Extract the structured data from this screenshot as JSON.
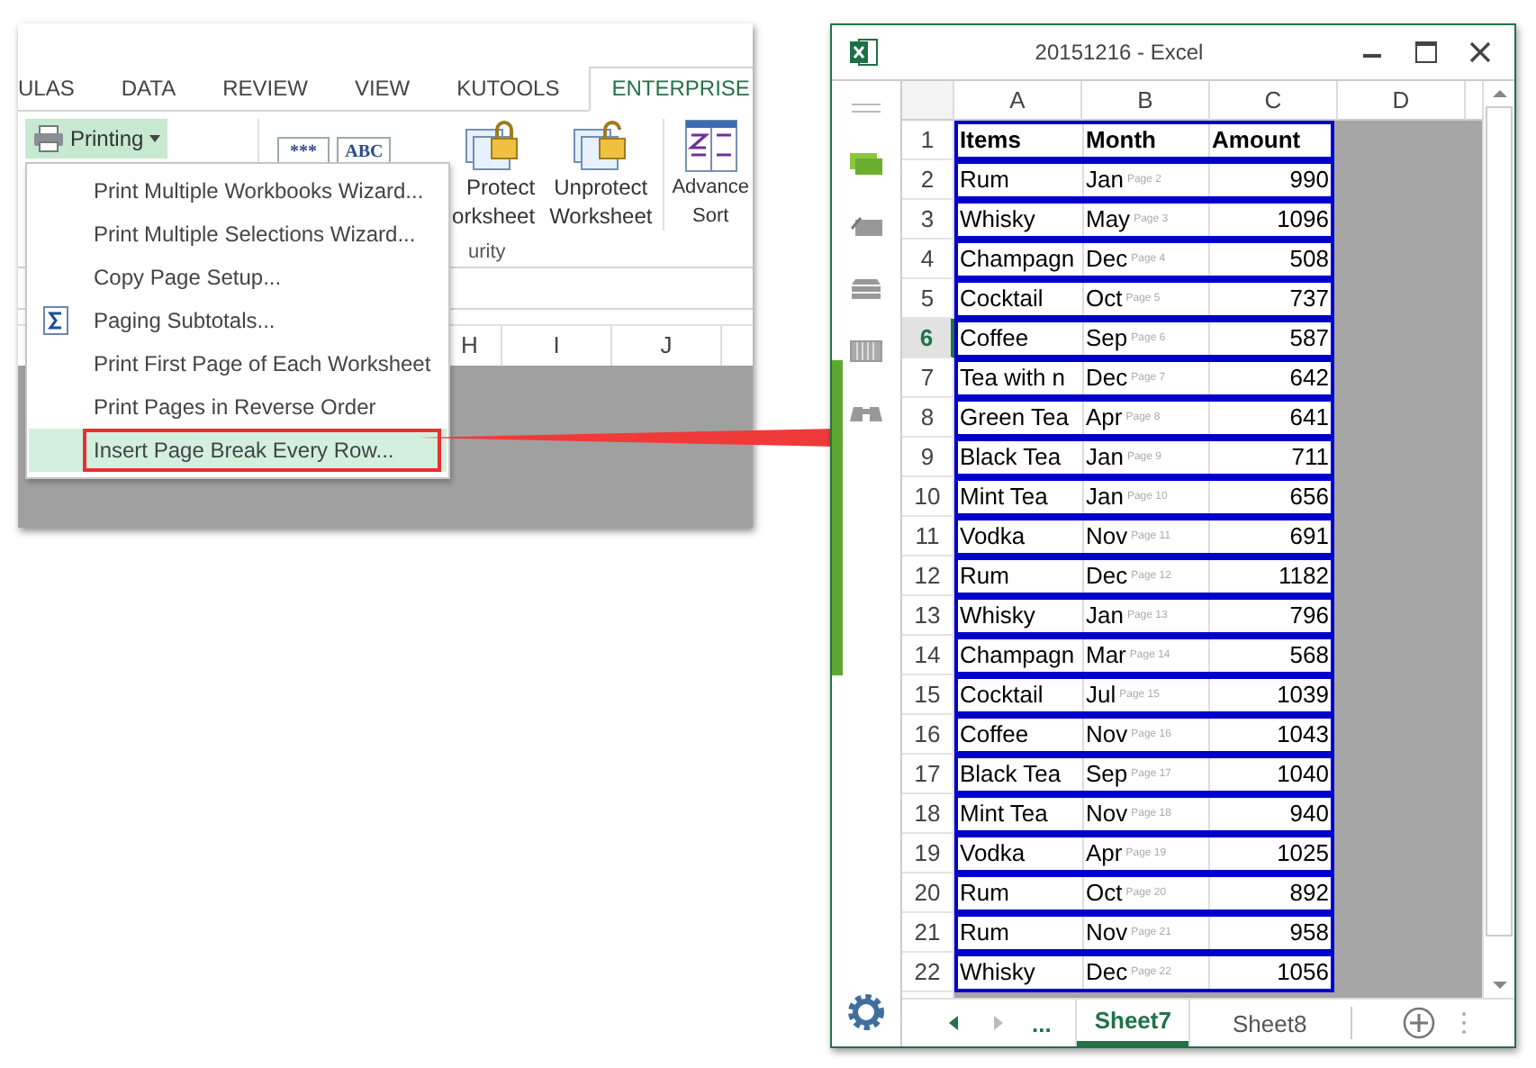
{
  "left_window": {
    "ribbon_tabs": [
      {
        "label": "ULAS",
        "selected": false
      },
      {
        "label": "DATA",
        "selected": false
      },
      {
        "label": "REVIEW",
        "selected": false
      },
      {
        "label": "VIEW",
        "selected": false
      },
      {
        "label": "KUTOOLS",
        "selected": false
      },
      {
        "label": "ENTERPRISE",
        "selected": true
      }
    ],
    "printing_button": {
      "label": "Printing",
      "expanded": true
    },
    "ribbon_icons": [
      "***",
      "ABC"
    ],
    "ribbon_buttons": [
      {
        "kind": "lock",
        "lines": [
          "Protect",
          "orksheet"
        ]
      },
      {
        "kind": "unlock",
        "lines": [
          "Unprotect",
          "Worksheet"
        ]
      },
      {
        "kind": "sort",
        "lines": [
          "Advance",
          "Sort"
        ]
      }
    ],
    "group_label": "urity",
    "column_headers": [
      "H",
      "I",
      "J"
    ],
    "menu": [
      {
        "label": "Print Multiple Workbooks Wizard...",
        "kind": "plain",
        "selected": false,
        "annotated": false
      },
      {
        "label": "Print Multiple Selections Wizard...",
        "kind": "plain",
        "selected": false,
        "annotated": false
      },
      {
        "label": "Copy Page Setup...",
        "kind": "plain",
        "selected": false,
        "annotated": false
      },
      {
        "label": "Paging Subtotals...",
        "kind": "subtotal",
        "selected": false,
        "annotated": false
      },
      {
        "label": "Print First Page of Each Worksheet",
        "kind": "plain",
        "selected": false,
        "annotated": false
      },
      {
        "label": "Print Pages in Reverse Order",
        "kind": "plain",
        "selected": false,
        "annotated": false
      },
      {
        "label": "Insert Page Break Every Row...",
        "kind": "plain",
        "selected": true,
        "annotated": true
      }
    ]
  },
  "excel_window": {
    "title": "20151216 - Excel",
    "columns": [
      "A",
      "B",
      "C",
      "D"
    ],
    "rows": [
      {
        "num": "1",
        "items": "Items",
        "month": "Month",
        "amount": "Amount",
        "kind": "header",
        "selected": false
      },
      {
        "num": "2",
        "items": "Rum",
        "month": "Jan",
        "page": "Page 2",
        "amount": "990",
        "kind": "data",
        "selected": false
      },
      {
        "num": "3",
        "items": "Whisky",
        "month": "May",
        "page": "Page 3",
        "amount": "1096",
        "kind": "data",
        "selected": false
      },
      {
        "num": "4",
        "items": "Champagn",
        "month": "Dec",
        "page": "Page 4",
        "amount": "508",
        "kind": "data",
        "selected": false
      },
      {
        "num": "5",
        "items": "Cocktail",
        "month": "Oct",
        "page": "Page 5",
        "amount": "737",
        "kind": "data",
        "selected": false
      },
      {
        "num": "6",
        "items": "Coffee",
        "month": "Sep",
        "page": "Page 6",
        "amount": "587",
        "kind": "data",
        "selected": true
      },
      {
        "num": "7",
        "items": "Tea with n",
        "month": "Dec",
        "page": "Page 7",
        "amount": "642",
        "kind": "data",
        "selected": false
      },
      {
        "num": "8",
        "items": "Green Tea",
        "month": "Apr",
        "page": "Page 8",
        "amount": "641",
        "kind": "data",
        "selected": false
      },
      {
        "num": "9",
        "items": "Black Tea",
        "month": "Jan",
        "page": "Page 9",
        "amount": "711",
        "kind": "data",
        "selected": false
      },
      {
        "num": "10",
        "items": "Mint Tea",
        "month": "Jan",
        "page": "Page 10",
        "amount": "656",
        "kind": "data",
        "selected": false
      },
      {
        "num": "11",
        "items": "Vodka",
        "month": "Nov",
        "page": "Page 11",
        "amount": "691",
        "kind": "data",
        "selected": false
      },
      {
        "num": "12",
        "items": "Rum",
        "month": "Dec",
        "page": "Page 12",
        "amount": "1182",
        "kind": "data",
        "selected": false
      },
      {
        "num": "13",
        "items": "Whisky",
        "month": "Jan",
        "page": "Page 13",
        "amount": "796",
        "kind": "data",
        "selected": false
      },
      {
        "num": "14",
        "items": "Champagn",
        "month": "Mar",
        "page": "Page 14",
        "amount": "568",
        "kind": "data",
        "selected": false
      },
      {
        "num": "15",
        "items": "Cocktail",
        "month": "Jul",
        "page": "Page 15",
        "amount": "1039",
        "kind": "data",
        "selected": false
      },
      {
        "num": "16",
        "items": "Coffee",
        "month": "Nov",
        "page": "Page 16",
        "amount": "1043",
        "kind": "data",
        "selected": false
      },
      {
        "num": "17",
        "items": "Black Tea",
        "month": "Sep",
        "page": "Page 17",
        "amount": "1040",
        "kind": "data",
        "selected": false
      },
      {
        "num": "18",
        "items": "Mint Tea",
        "month": "Nov",
        "page": "Page 18",
        "amount": "940",
        "kind": "data",
        "selected": false
      },
      {
        "num": "19",
        "items": "Vodka",
        "month": "Apr",
        "page": "Page 19",
        "amount": "1025",
        "kind": "data",
        "selected": false
      },
      {
        "num": "20",
        "items": "Rum",
        "month": "Oct",
        "page": "Page 20",
        "amount": "892",
        "kind": "data",
        "selected": false
      },
      {
        "num": "21",
        "items": "Rum",
        "month": "Nov",
        "page": "Page 21",
        "amount": "958",
        "kind": "data",
        "selected": false
      },
      {
        "num": "22",
        "items": "Whisky",
        "month": "Dec",
        "page": "Page 22",
        "amount": "1056",
        "kind": "data",
        "selected": false
      }
    ],
    "sheet_overflow": "...",
    "sheet_tabs": [
      {
        "label": "Sheet7",
        "selected": true
      },
      {
        "label": "Sheet8",
        "selected": false
      }
    ]
  }
}
